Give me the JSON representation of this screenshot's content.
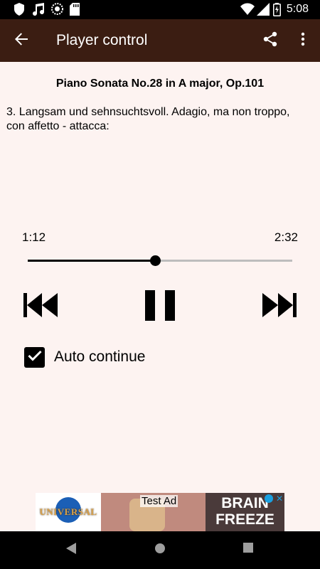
{
  "status_bar": {
    "time": "5:08",
    "icons": [
      "shield-icon",
      "music-note-icon",
      "sync-icon",
      "sd-card-icon",
      "wifi-icon",
      "signal-icon",
      "battery-charging-icon"
    ]
  },
  "app_bar": {
    "title": "Player control",
    "icons": [
      "back-arrow-icon",
      "share-icon",
      "more-vert-icon"
    ]
  },
  "track": {
    "title": "Piano Sonata No.28 in A major, Op.101",
    "movement": "3. Langsam und sehnsuchtsvoll. Adagio, ma non troppo, con affetto - attacca:"
  },
  "player": {
    "elapsed": "1:12",
    "duration": "2:32",
    "progress": 0.48,
    "state": "playing",
    "controls": [
      "skip-previous-icon",
      "pause-icon",
      "skip-next-icon"
    ]
  },
  "auto_continue": {
    "label": "Auto continue",
    "checked": true
  },
  "ad": {
    "label": "Test Ad",
    "logo_text": "UNIVERSAL",
    "brand_line1": "BRAIN",
    "brand_line2": "FREEZE"
  },
  "colors": {
    "app_bar": "#3b1d12",
    "background": "#fdf3f1",
    "accent": "#000000"
  }
}
